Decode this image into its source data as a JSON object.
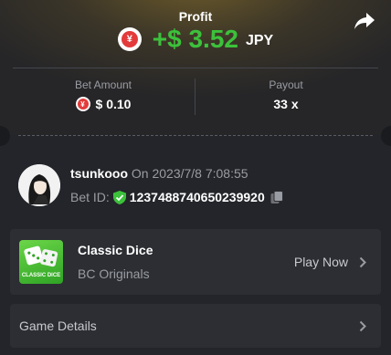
{
  "header": {
    "profit_label": "Profit",
    "profit_amount": "+$ 3.52",
    "profit_currency": "JPY",
    "currency_symbol": "¥",
    "profit_color": "#3cc13b"
  },
  "stats": {
    "bet_amount_label": "Bet Amount",
    "bet_amount_value": "$ 0.10",
    "payout_label": "Payout",
    "payout_value": "33 x"
  },
  "user": {
    "name": "tsunkooo",
    "date": "On 2023/7/8 7:08:55",
    "bet_id_label": "Bet ID:",
    "bet_id": "1237488740650239920"
  },
  "game": {
    "thumb_text": "CLASSIC DICE",
    "name": "Classic Dice",
    "provider": "BC Originals",
    "play_label": "Play Now"
  },
  "details": {
    "label": "Game Details"
  },
  "icons": {
    "share": "share-icon",
    "coin": "yen-coin-icon",
    "shield": "verified-shield-icon",
    "copy": "copy-icon",
    "chevron": "chevron-right-icon"
  },
  "colors": {
    "background": "#23252a",
    "card": "#2c2e33",
    "accent_green": "#3cc13b",
    "coin_red": "#e33b3b"
  }
}
